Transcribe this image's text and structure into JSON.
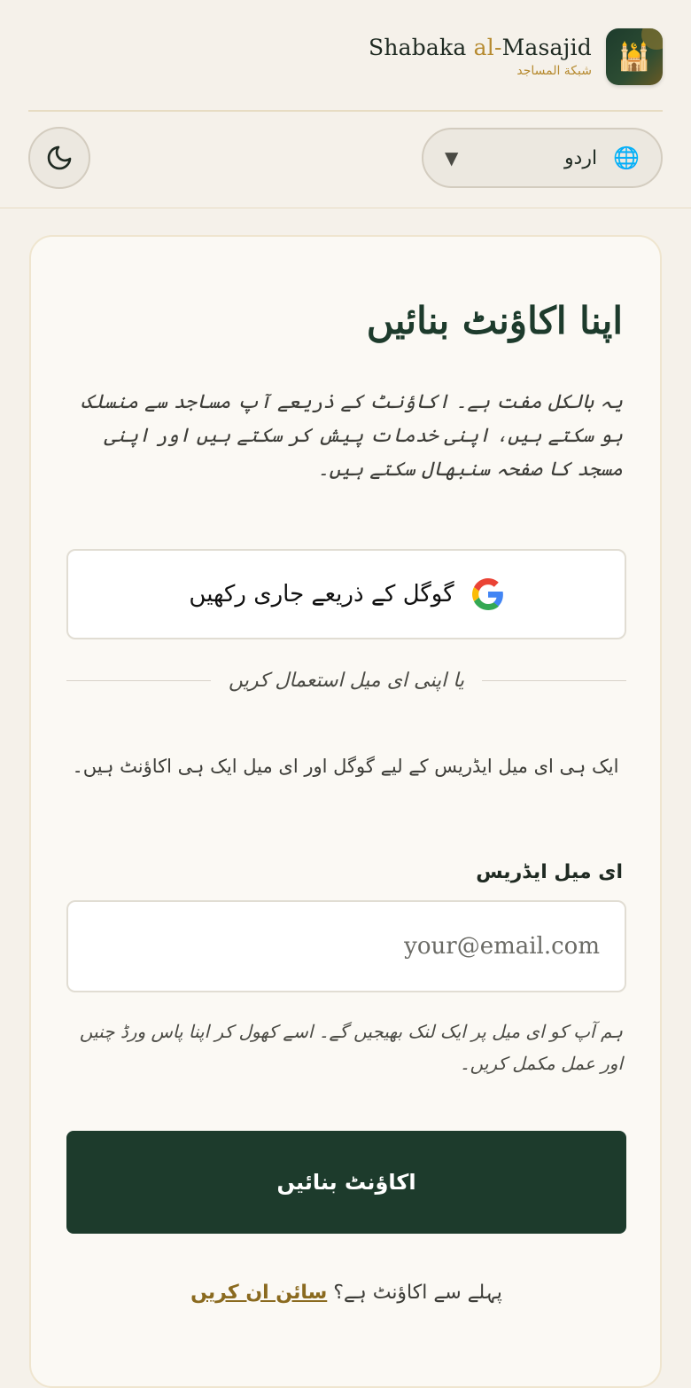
{
  "header": {
    "brand_name_part1": "Shabaka ",
    "brand_name_part2": "al-",
    "brand_name_part3": "Masajid",
    "brand_sub": "شبكة المساجد",
    "logo_icon": "mosque-icon",
    "theme_toggle_icon": "moon-icon",
    "language": {
      "selected": "اردو",
      "icon": "globe-icon",
      "caret": "▼"
    }
  },
  "signup": {
    "title": "اپنا اکاؤنٹ بنائیں",
    "intro": "یہ بالکل مفت ہے۔ اکاؤنٹ کے ذریعے آپ مساجد سے منسلک ہو سکتے ہیں، اپنی خدمات پیش کر سکتے ہیں اور اپنی مسجد کا صفحہ سنبھال سکتے ہیں۔",
    "google_button": "گوگل کے ذریعے جاری رکھیں",
    "or_divider": "یا اپنی ای میل استعمال کریں",
    "same_email_note": "ایک ہی ای میل ایڈریس کے لیے گوگل اور ای میل ایک ہی اکاؤنٹ ہیں۔",
    "email_label": "ای میل ایڈریس",
    "email_placeholder": "your@email.com",
    "email_value": "",
    "email_help": "ہم آپ کو ای میل پر ایک لنک بھیجیں گے۔ اسے کھول کر اپنا پاس ورڈ چنیں اور عمل مکمل کریں۔",
    "submit_button": "اکاؤنٹ بنائیں",
    "have_account": "پہلے سے اکاؤنٹ ہے؟ ",
    "signin_link": "سائن ان کریں"
  },
  "colors": {
    "primary": "#1d3b2c",
    "accent": "#b68a2f",
    "background": "#f5f1ea",
    "card": "#fbf9f4"
  }
}
